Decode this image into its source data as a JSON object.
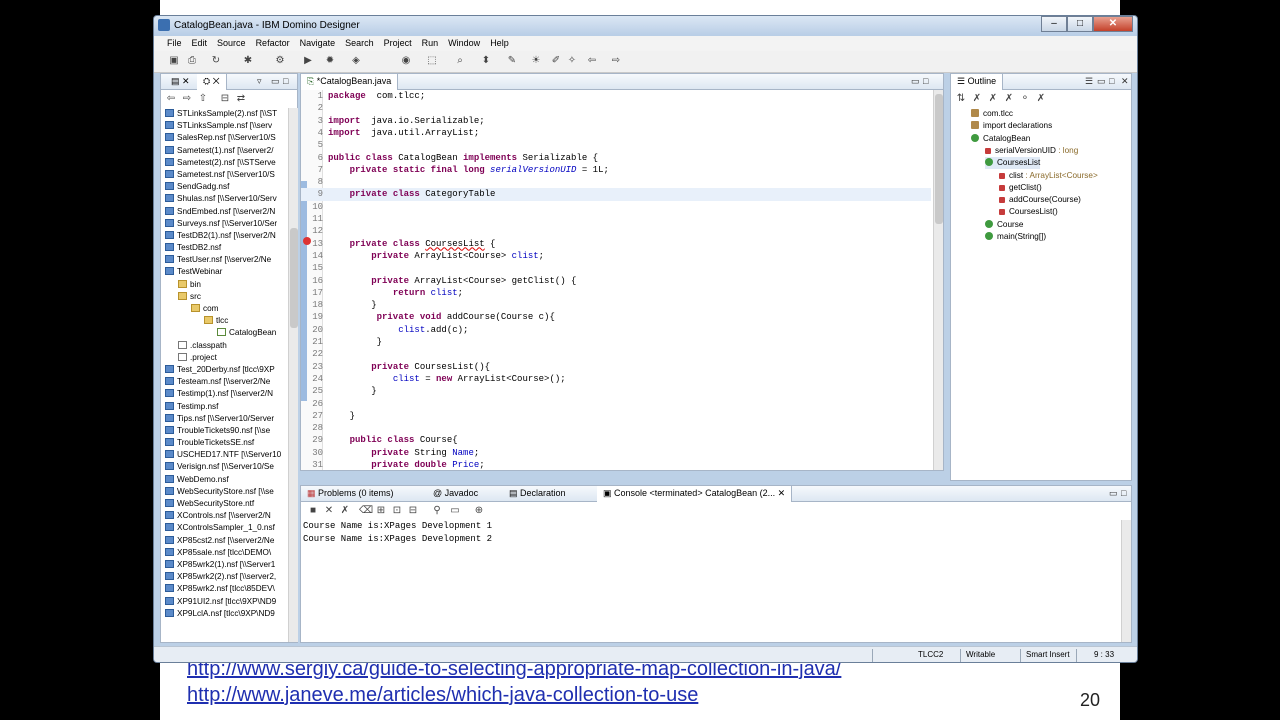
{
  "window": {
    "title": "CatalogBean.java - IBM Domino Designer",
    "controls": {
      "minimize": "–",
      "maximize": "□",
      "close": "✕"
    }
  },
  "menu": [
    "File",
    "Edit",
    "Source",
    "Refactor",
    "Navigate",
    "Search",
    "Project",
    "Run",
    "Window",
    "Help"
  ],
  "navigator": {
    "items": [
      {
        "label": "STLinksSample(2).nsf [\\\\ST",
        "kind": "db",
        "indent": 0
      },
      {
        "label": "STLinksSample.nsf [\\\\serv",
        "kind": "db",
        "indent": 0
      },
      {
        "label": "SalesRep.nsf [\\\\Server10/S",
        "kind": "db",
        "indent": 0
      },
      {
        "label": "Sametest(1).nsf [\\\\server2/",
        "kind": "db",
        "indent": 0
      },
      {
        "label": "Sametest(2).nsf [\\\\STServe",
        "kind": "db",
        "indent": 0
      },
      {
        "label": "Sametest.nsf [\\\\Server10/S",
        "kind": "db",
        "indent": 0
      },
      {
        "label": "SendGadg.nsf",
        "kind": "db",
        "indent": 0
      },
      {
        "label": "Shulas.nsf [\\\\Server10/Serv",
        "kind": "db",
        "indent": 0
      },
      {
        "label": "SndEmbed.nsf [\\\\server2/N",
        "kind": "db",
        "indent": 0
      },
      {
        "label": "Surveys.nsf [\\\\Server10/Ser",
        "kind": "db",
        "indent": 0
      },
      {
        "label": "TestDB2(1).nsf [\\\\server2/N",
        "kind": "db",
        "indent": 0
      },
      {
        "label": "TestDB2.nsf",
        "kind": "db",
        "indent": 0
      },
      {
        "label": "TestUser.nsf [\\\\server2/Ne",
        "kind": "db",
        "indent": 0
      },
      {
        "label": "TestWebinar",
        "kind": "db",
        "indent": 0
      },
      {
        "label": "bin",
        "kind": "folder",
        "indent": 1
      },
      {
        "label": "src",
        "kind": "folder",
        "indent": 1
      },
      {
        "label": "com",
        "kind": "folder",
        "indent": 2
      },
      {
        "label": "tlcc",
        "kind": "folder",
        "indent": 3
      },
      {
        "label": "CatalogBean",
        "kind": "java",
        "indent": 4
      },
      {
        "label": ".classpath",
        "kind": "file",
        "indent": 1
      },
      {
        "label": ".project",
        "kind": "file",
        "indent": 1
      },
      {
        "label": "Test_20Derby.nsf [tlcc\\9XP",
        "kind": "db",
        "indent": 0
      },
      {
        "label": "Testeam.nsf [\\\\server2/Ne",
        "kind": "db",
        "indent": 0
      },
      {
        "label": "Testimp(1).nsf [\\\\server2/N",
        "kind": "db",
        "indent": 0
      },
      {
        "label": "Testimp.nsf",
        "kind": "db",
        "indent": 0
      },
      {
        "label": "Tips.nsf [\\\\Server10/Server",
        "kind": "db",
        "indent": 0
      },
      {
        "label": "TroubleTickets90.nsf [\\\\se",
        "kind": "db",
        "indent": 0
      },
      {
        "label": "TroubleTicketsSE.nsf",
        "kind": "db",
        "indent": 0
      },
      {
        "label": "USCHED17.NTF [\\\\Server10",
        "kind": "db",
        "indent": 0
      },
      {
        "label": "Verisign.nsf [\\\\Server10/Se",
        "kind": "db",
        "indent": 0
      },
      {
        "label": "WebDemo.nsf",
        "kind": "db",
        "indent": 0
      },
      {
        "label": "WebSecurityStore.nsf [\\\\se",
        "kind": "db",
        "indent": 0
      },
      {
        "label": "WebSecurityStore.ntf",
        "kind": "db",
        "indent": 0
      },
      {
        "label": "XControls.nsf [\\\\server2/N",
        "kind": "db",
        "indent": 0
      },
      {
        "label": "XControlsSampler_1_0.nsf",
        "kind": "db",
        "indent": 0
      },
      {
        "label": "XP85cst2.nsf [\\\\server2/Ne",
        "kind": "db",
        "indent": 0
      },
      {
        "label": "XP85sale.nsf [tlcc\\DEMO\\",
        "kind": "db",
        "indent": 0
      },
      {
        "label": "XP85wrk2(1).nsf [\\\\Server1",
        "kind": "db",
        "indent": 0
      },
      {
        "label": "XP85wrk2(2).nsf [\\\\server2,",
        "kind": "db",
        "indent": 0
      },
      {
        "label": "XP85wrk2.nsf [tlcc\\85DEV\\",
        "kind": "db",
        "indent": 0
      },
      {
        "label": "XP91UI2.nsf [tlcc\\9XP\\ND9",
        "kind": "db",
        "indent": 0
      },
      {
        "label": "XP9LclA.nsf [tlcc\\9XP\\ND9",
        "kind": "db",
        "indent": 0
      }
    ]
  },
  "editor": {
    "tab": "*CatalogBean.java",
    "lines": [
      {
        "n": "1",
        "code": [
          [
            "kw",
            "package"
          ],
          [
            "",
            "  com.tlcc;"
          ]
        ]
      },
      {
        "n": "2",
        "code": []
      },
      {
        "n": "3",
        "code": [
          [
            "kw",
            "import"
          ],
          [
            "",
            "  java.io.Serializable;"
          ]
        ]
      },
      {
        "n": "4",
        "code": [
          [
            "kw",
            "import"
          ],
          [
            "",
            "  java.util.ArrayList;"
          ]
        ]
      },
      {
        "n": "5",
        "code": []
      },
      {
        "n": "6",
        "code": [
          [
            "kw",
            "public class"
          ],
          [
            "",
            " CatalogBean "
          ],
          [
            "kw",
            "implements"
          ],
          [
            "",
            " Serializable {"
          ]
        ]
      },
      {
        "n": "7",
        "code": [
          [
            "",
            "    "
          ],
          [
            "kw",
            "private static final long"
          ],
          [
            "",
            " "
          ],
          [
            "sfld",
            "serialVersionUID"
          ],
          [
            "",
            " = 1L;"
          ]
        ]
      },
      {
        "n": "8",
        "code": []
      },
      {
        "n": "9",
        "code": [
          [
            "",
            "    "
          ],
          [
            "kw",
            "private class"
          ],
          [
            "",
            " CategoryTable"
          ]
        ]
      },
      {
        "n": "10",
        "code": []
      },
      {
        "n": "11",
        "code": []
      },
      {
        "n": "12",
        "code": []
      },
      {
        "n": "13",
        "code": [
          [
            "",
            "    "
          ],
          [
            "kw",
            "private class"
          ],
          [
            "",
            " "
          ],
          [
            "err",
            "CoursesList"
          ],
          [
            "",
            " {"
          ]
        ]
      },
      {
        "n": "14",
        "code": [
          [
            "",
            "        "
          ],
          [
            "kw",
            "private"
          ],
          [
            "",
            " ArrayList<Course> "
          ],
          [
            "fld",
            "clist"
          ],
          [
            "",
            ";"
          ]
        ]
      },
      {
        "n": "15",
        "code": []
      },
      {
        "n": "16",
        "code": [
          [
            "",
            "        "
          ],
          [
            "kw",
            "private"
          ],
          [
            "",
            " ArrayList<Course> getClist() {"
          ]
        ]
      },
      {
        "n": "17",
        "code": [
          [
            "",
            "            "
          ],
          [
            "kw",
            "return"
          ],
          [
            "",
            " "
          ],
          [
            "fld",
            "clist"
          ],
          [
            "",
            ";"
          ]
        ]
      },
      {
        "n": "18",
        "code": [
          [
            "",
            "        }"
          ]
        ]
      },
      {
        "n": "19",
        "code": [
          [
            "",
            "         "
          ],
          [
            "kw",
            "private void"
          ],
          [
            "",
            " addCourse(Course c){"
          ]
        ]
      },
      {
        "n": "20",
        "code": [
          [
            "",
            "             "
          ],
          [
            "fld",
            "clist"
          ],
          [
            "",
            ".add(c);"
          ]
        ]
      },
      {
        "n": "21",
        "code": [
          [
            "",
            "         }"
          ]
        ]
      },
      {
        "n": "22",
        "code": []
      },
      {
        "n": "23",
        "code": [
          [
            "",
            "        "
          ],
          [
            "kw",
            "private"
          ],
          [
            "",
            " CoursesList(){"
          ]
        ]
      },
      {
        "n": "24",
        "code": [
          [
            "",
            "            "
          ],
          [
            "fld",
            "clist"
          ],
          [
            "",
            " = "
          ],
          [
            "kw",
            "new"
          ],
          [
            "",
            " ArrayList<Course>();"
          ]
        ]
      },
      {
        "n": "25",
        "code": [
          [
            "",
            "        }"
          ]
        ]
      },
      {
        "n": "26",
        "code": []
      },
      {
        "n": "27",
        "code": [
          [
            "",
            "    }"
          ]
        ]
      },
      {
        "n": "28",
        "code": []
      },
      {
        "n": "29",
        "code": [
          [
            "",
            "    "
          ],
          [
            "kw",
            "public class"
          ],
          [
            "",
            " Course{"
          ]
        ]
      },
      {
        "n": "30",
        "code": [
          [
            "",
            "        "
          ],
          [
            "kw",
            "private"
          ],
          [
            "",
            " String "
          ],
          [
            "fld",
            "Name"
          ],
          [
            "",
            ";"
          ]
        ]
      },
      {
        "n": "31",
        "code": [
          [
            "",
            "        "
          ],
          [
            "kw",
            "private double"
          ],
          [
            "",
            " "
          ],
          [
            "fld",
            "Price"
          ],
          [
            "",
            ";"
          ]
        ]
      }
    ]
  },
  "outline": {
    "title": "Outline",
    "items": [
      {
        "label": "com.tlcc",
        "detail": "",
        "icon": "pkg",
        "indent": 0
      },
      {
        "label": "import declarations",
        "detail": "",
        "icon": "pkg",
        "indent": 0
      },
      {
        "label": "CatalogBean",
        "detail": "",
        "icon": "green",
        "indent": 0
      },
      {
        "label": "serialVersionUID",
        "detail": " : long",
        "icon": "red",
        "indent": 1
      },
      {
        "label": "CoursesList",
        "detail": "",
        "icon": "green",
        "indent": 1
      },
      {
        "label": "clist",
        "detail": " : ArrayList<Course>",
        "icon": "red",
        "indent": 2
      },
      {
        "label": "getClist()",
        "detail": "",
        "icon": "red",
        "indent": 2
      },
      {
        "label": "addCourse(Course)",
        "detail": "",
        "icon": "red",
        "indent": 2
      },
      {
        "label": "CoursesList()",
        "detail": "",
        "icon": "red",
        "indent": 2
      },
      {
        "label": "Course",
        "detail": "",
        "icon": "green",
        "indent": 1
      },
      {
        "label": "main(String[])",
        "detail": "",
        "icon": "green",
        "indent": 1
      }
    ]
  },
  "bottom": {
    "tabs": [
      "Problems (0 items)",
      "@ Javadoc",
      "Declaration",
      "Console <terminated> CatalogBean (2..."
    ],
    "console": [
      "Course Name is:XPages Development 1",
      "Course Name is:XPages Development 2"
    ]
  },
  "status": {
    "server": "TLCC2",
    "mode": "Writable",
    "insert": "Smart Insert",
    "position": "9 : 33"
  },
  "slide": {
    "links": [
      "http://www.sergiy.ca/guide-to-selecting-appropriate-map-collection-in-java/",
      "http://www.janeve.me/articles/which-java-collection-to-use"
    ],
    "page": "20"
  }
}
